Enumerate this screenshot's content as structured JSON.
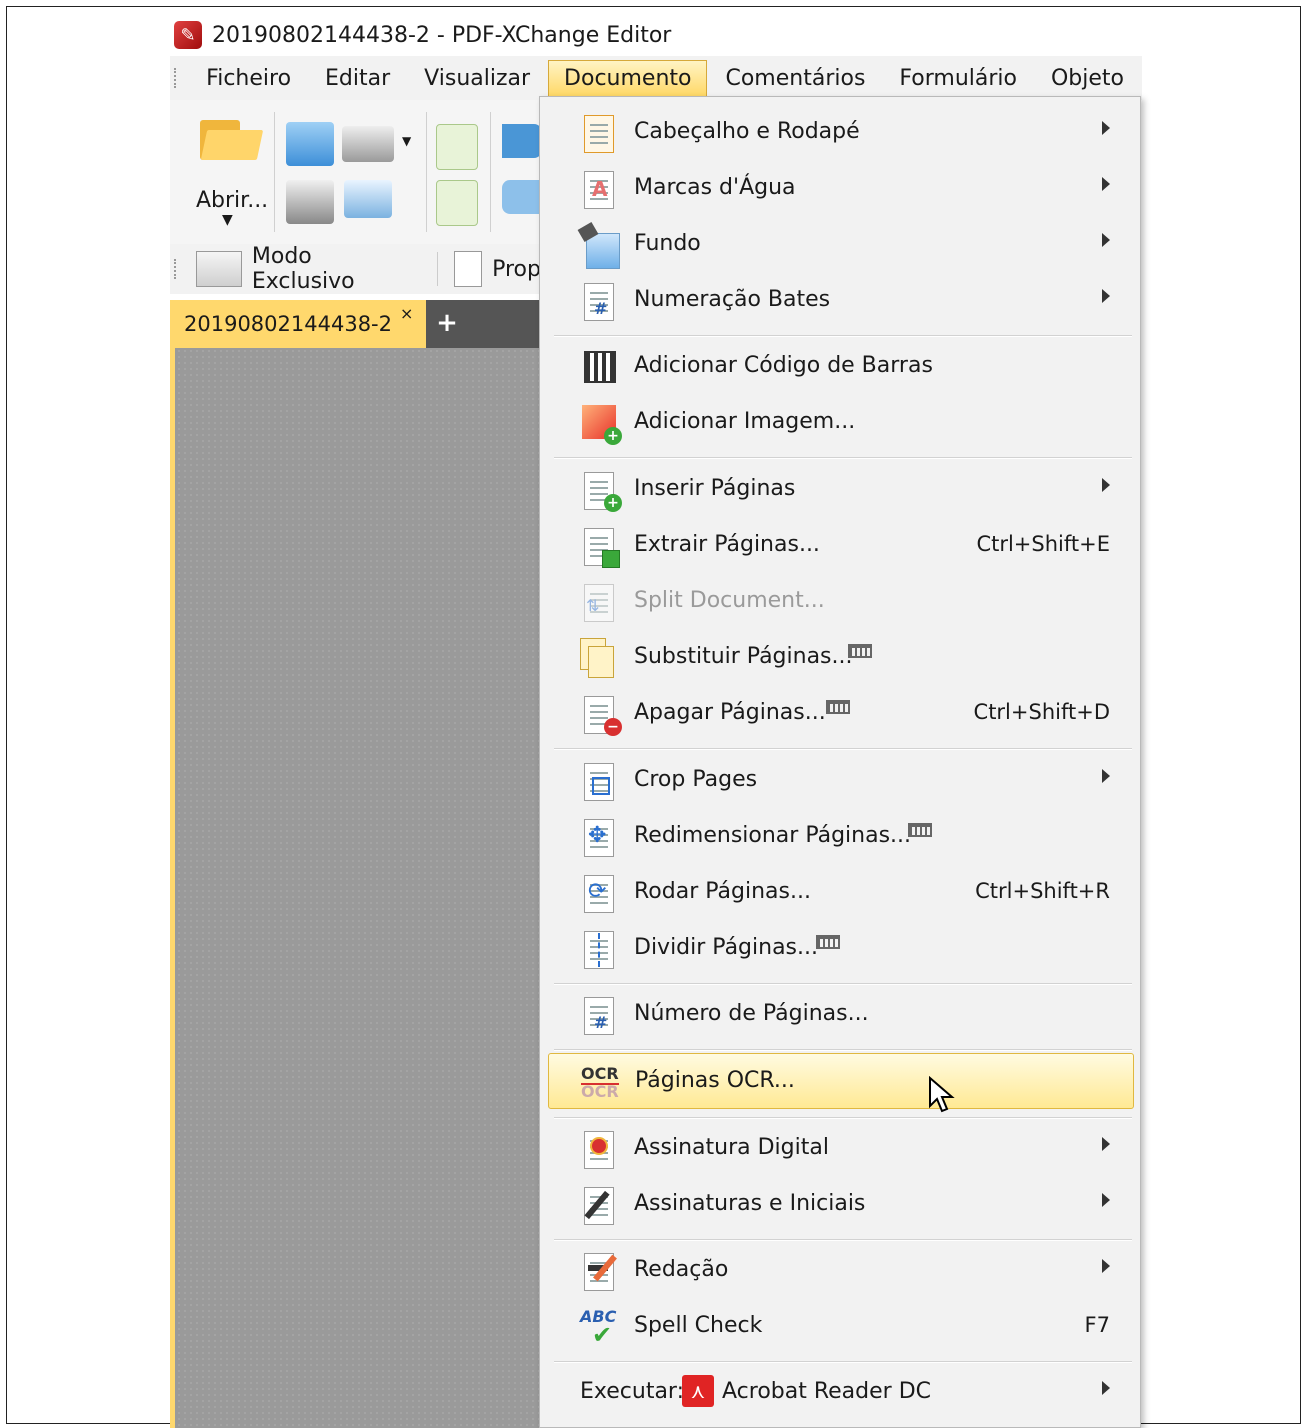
{
  "window": {
    "title": "20190802144438-2 - PDF-XChange Editor"
  },
  "menubar": {
    "items": [
      "Ficheiro",
      "Editar",
      "Visualizar",
      "Documento",
      "Comentários",
      "Formulário",
      "Objeto"
    ],
    "active": "Documento"
  },
  "ribbon": {
    "open_label": "Abrir...",
    "exclusive_mode_label": "Modo Exclusivo",
    "properties_label": "Propr"
  },
  "tabs": {
    "document_tab": "20190802144438-2",
    "close_glyph": "×",
    "add_glyph": "+"
  },
  "documento_menu": {
    "items": [
      {
        "label": "Cabeçalho e Rodapé",
        "submenu": true
      },
      {
        "label": "Marcas d'Água",
        "submenu": true
      },
      {
        "label": "Fundo",
        "submenu": true
      },
      {
        "label": "Numeração Bates",
        "submenu": true
      },
      {
        "label": "Adicionar Código de Barras"
      },
      {
        "label": "Adicionar Imagem..."
      },
      {
        "label": "Inserir Páginas",
        "submenu": true
      },
      {
        "label": "Extrair Páginas...",
        "shortcut": "Ctrl+Shift+E"
      },
      {
        "label": "Split Document...",
        "disabled": true
      },
      {
        "label": "Substituir Páginas...",
        "cart": true
      },
      {
        "label": "Apagar Páginas...",
        "cart": true,
        "shortcut": "Ctrl+Shift+D"
      },
      {
        "label": "Crop Pages",
        "submenu": true
      },
      {
        "label": "Redimensionar Páginas...",
        "cart": true
      },
      {
        "label": "Rodar Páginas...",
        "shortcut": "Ctrl+Shift+R"
      },
      {
        "label": "Dividir Páginas...",
        "cart": true
      },
      {
        "label": "Número de Páginas..."
      },
      {
        "label": "Páginas OCR...",
        "highlighted": true
      },
      {
        "label": "Assinatura Digital",
        "submenu": true
      },
      {
        "label": "Assinaturas e Iniciais",
        "submenu": true
      },
      {
        "label": "Redação",
        "submenu": true
      },
      {
        "label": "Spell Check",
        "shortcut": "F7"
      }
    ],
    "execute": {
      "prefix": "Executar:",
      "app": "Acrobat Reader DC",
      "submenu": true
    },
    "ocr_icon_text": "OCR",
    "spell_icon_text": "ABC",
    "bates_icon_text": "#"
  },
  "colors": {
    "highlight": "#ffe994",
    "active_tab": "#ffd86d",
    "menu_bg": "#f2f2f2"
  }
}
